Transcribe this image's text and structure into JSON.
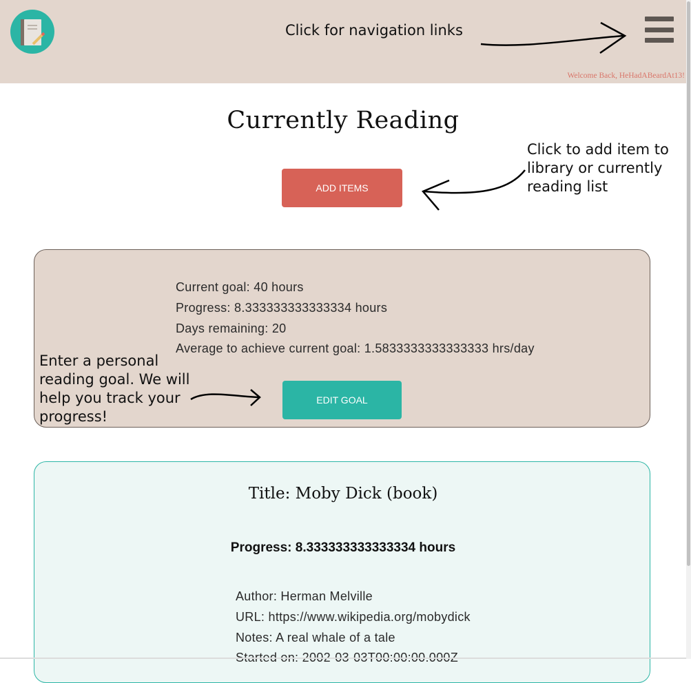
{
  "header": {
    "logo_icon": "notebook-icon",
    "menu_icon": "hamburger-menu-icon",
    "welcome": "Welcome Back, HeHadABeardAt13!"
  },
  "annotations": {
    "nav": "Click for navigation links",
    "add": [
      "Click to add item to",
      "library or currently",
      "reading list"
    ],
    "goal": [
      "Enter a personal",
      "reading goal.  We will",
      "help you track your",
      "progress!"
    ]
  },
  "page": {
    "title": "Currently Reading",
    "add_button": "ADD ITEMS"
  },
  "goal": {
    "current": "Current goal: 40 hours",
    "progress": "Progress: 8.333333333333334 hours",
    "days": "Days remaining: 20",
    "average": "Average to achieve current goal: 1.5833333333333333 hrs/day",
    "edit_button": "EDIT GOAL"
  },
  "item": {
    "title": "Title: Moby Dick (book)",
    "progress": "Progress: 8.333333333333334 hours",
    "author": "Author: Herman Melville",
    "url": "URL: https://www.wikipedia.org/mobydick",
    "notes": "Notes: A real whale of a tale",
    "started": "Started on: 2002-03-03T00:00:00.000Z"
  },
  "colors": {
    "header_bg": "#e3d6cd",
    "accent_teal": "#2bb5a5",
    "accent_red": "#d76257",
    "welcome_text": "#d9766a"
  }
}
